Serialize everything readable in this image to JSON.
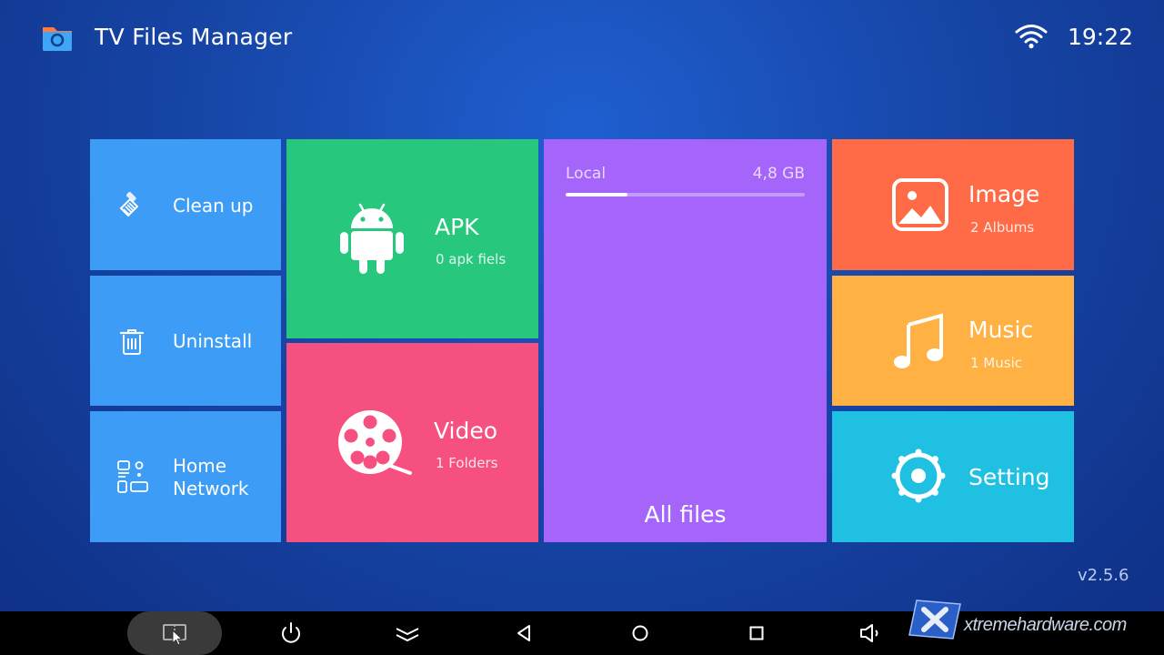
{
  "header": {
    "app_title": "TV Files Manager",
    "app_icon": "folder-icon",
    "wifi_icon": "wifi-icon",
    "time": "19:22"
  },
  "tiles": {
    "clean_up": {
      "label": "Clean up",
      "icon": "broom-icon",
      "color": "#3d9cf5"
    },
    "uninstall": {
      "label": "Uninstall",
      "icon": "trash-icon",
      "color": "#3d9cf5"
    },
    "home_network": {
      "label_line1": "Home",
      "label_line2": "Network",
      "icon": "network-icon",
      "color": "#3d9cf5"
    },
    "apk": {
      "title": "APK",
      "subtitle": "0 apk fiels",
      "icon": "android-icon",
      "color": "#27c77e"
    },
    "video": {
      "title": "Video",
      "subtitle": "1 Folders",
      "icon": "film-reel-icon",
      "color": "#f5507f"
    },
    "all_files": {
      "storage_label": "Local",
      "storage_size": "4,8 GB",
      "usage_fraction": 0.26,
      "label": "All files",
      "color": "#a565fb"
    },
    "image": {
      "title": "Image",
      "subtitle": "2 Albums",
      "icon": "picture-icon",
      "color": "#ff6b47"
    },
    "music": {
      "title": "Music",
      "subtitle": "1 Music",
      "icon": "music-note-icon",
      "color": "#ffb143"
    },
    "setting": {
      "title": "Setting",
      "icon": "gear-icon",
      "color": "#1fc0e2"
    }
  },
  "version": "v2.5.6",
  "navbar": {
    "buttons": [
      "screen-mirror-icon",
      "power-icon",
      "expand-down-icon",
      "back-icon",
      "home-icon",
      "recents-icon",
      "volume-down-icon"
    ]
  },
  "watermark": {
    "text": "xtremehardware.com"
  }
}
